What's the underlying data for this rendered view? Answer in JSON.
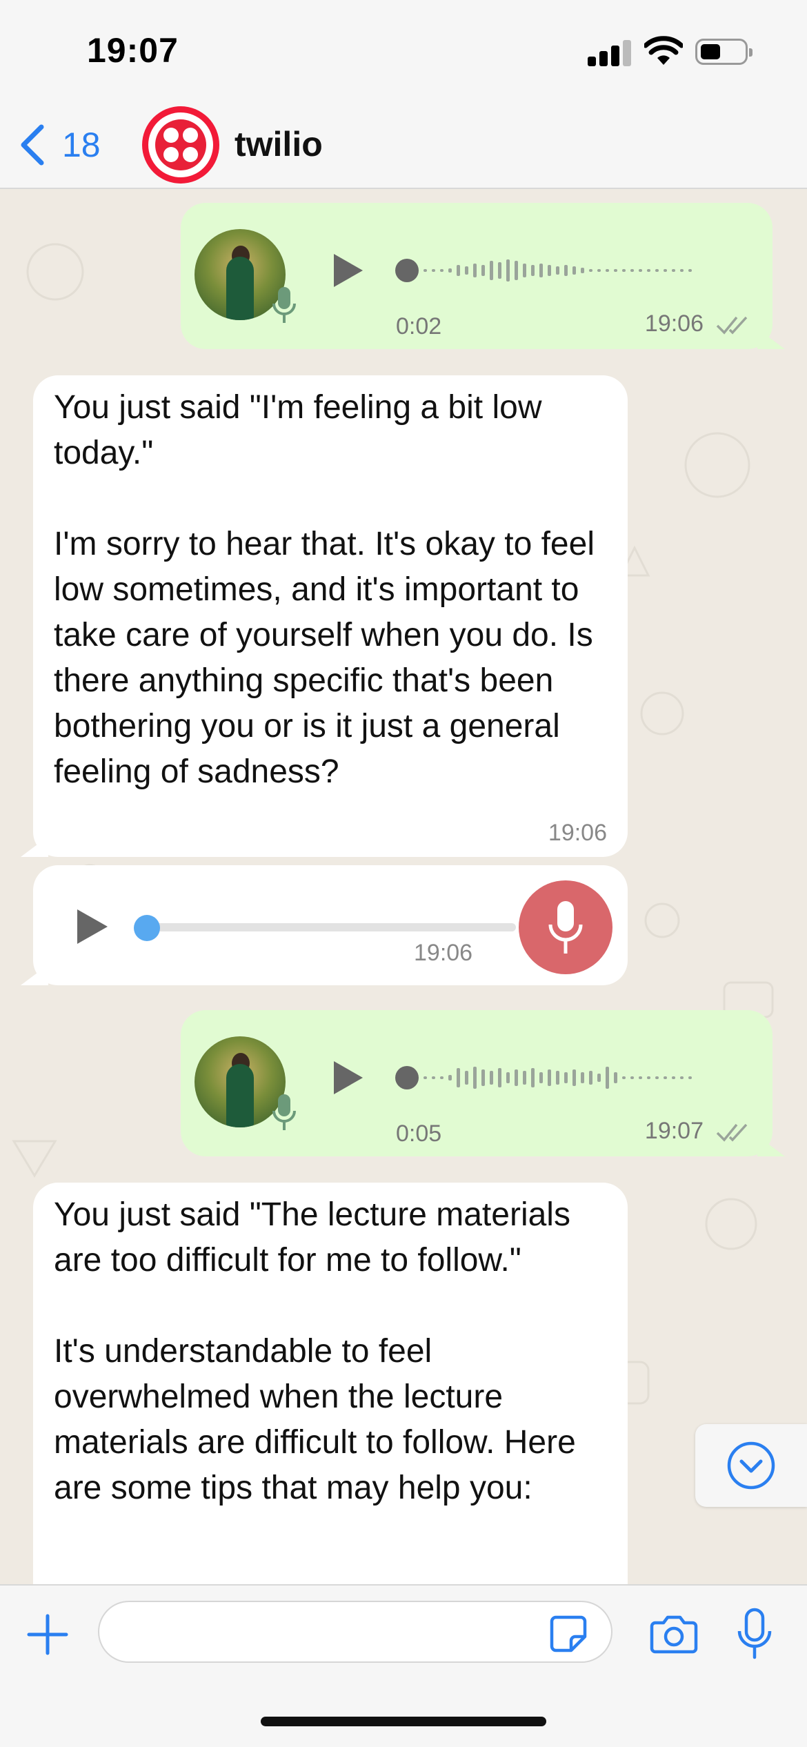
{
  "status_bar": {
    "time": "19:07"
  },
  "header": {
    "back_count": "18",
    "contact_name": "twilio"
  },
  "messages": [
    {
      "type": "voice_out",
      "duration": "0:02",
      "time": "19:06"
    },
    {
      "type": "text_in",
      "text": "You just said \"I'm feeling a bit low today.\"\n\nI'm sorry to hear that. It's okay to feel low sometimes, and it's important to take care of yourself when you do. Is there anything specific that's been bothering you or is it just a general feeling of sadness?",
      "time": "19:06"
    },
    {
      "type": "audio_in",
      "time": "19:06"
    },
    {
      "type": "voice_out",
      "duration": "0:05",
      "time": "19:07"
    },
    {
      "type": "text_in",
      "text": "You just said \"The lecture materials are too difficult for me to follow.\"\n\nIt's understandable to feel overwhelmed when the lecture materials are difficult to follow. Here are some tips that may help you:"
    }
  ],
  "input": {
    "placeholder": ""
  },
  "colors": {
    "accent": "#2a7ff0",
    "outgoing_bubble": "#e1fbd2",
    "incoming_bubble": "#ffffff",
    "chat_background": "#efeae2",
    "record_button": "#d9676b",
    "brand": "#f21a38"
  }
}
